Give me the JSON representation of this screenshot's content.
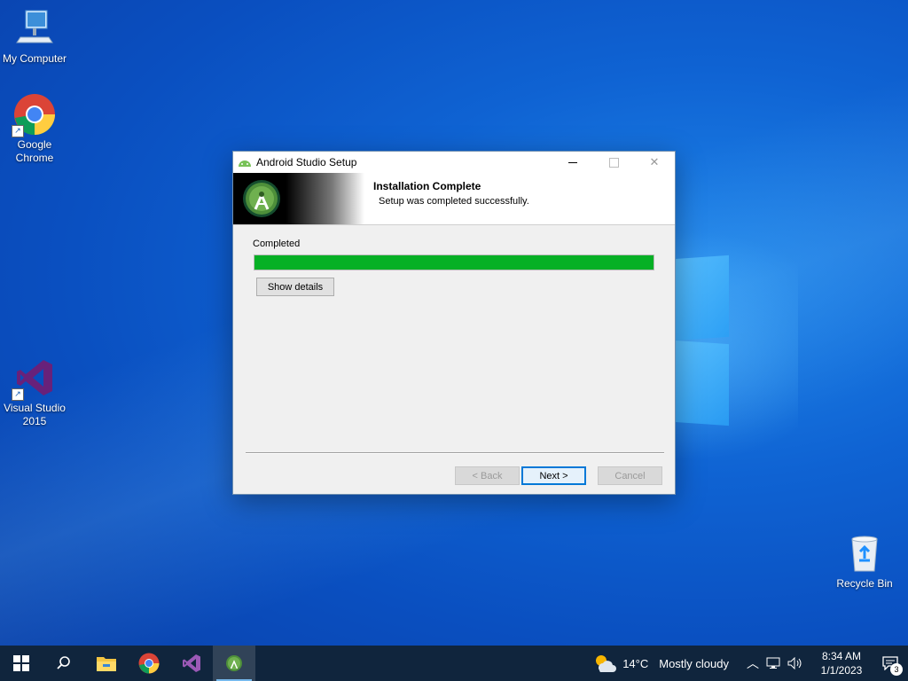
{
  "desktop": {
    "icons": [
      {
        "label": "My Computer"
      },
      {
        "label": "Google Chrome"
      },
      {
        "label": "Visual Studio 2015"
      },
      {
        "label": "Recycle Bin"
      }
    ]
  },
  "window": {
    "title": "Android Studio Setup",
    "header_title": "Installation Complete",
    "header_subtitle": "Setup was completed successfully.",
    "status_label": "Completed",
    "progress_percent": 100,
    "show_details_label": "Show details",
    "back_label": "< Back",
    "next_label": "Next >",
    "cancel_label": "Cancel"
  },
  "taskbar": {
    "items": [
      "start-icon",
      "search-icon",
      "file-explorer-icon",
      "chrome-icon",
      "visual-studio-icon",
      "android-studio-icon"
    ],
    "weather_temp": "14°C",
    "weather_text": "Mostly cloudy",
    "time": "8:34 AM",
    "date": "1/1/2023",
    "notification_count": "3"
  },
  "colors": {
    "progress": "#06b025",
    "taskbar": "#10253d",
    "accent": "#0078d7"
  }
}
